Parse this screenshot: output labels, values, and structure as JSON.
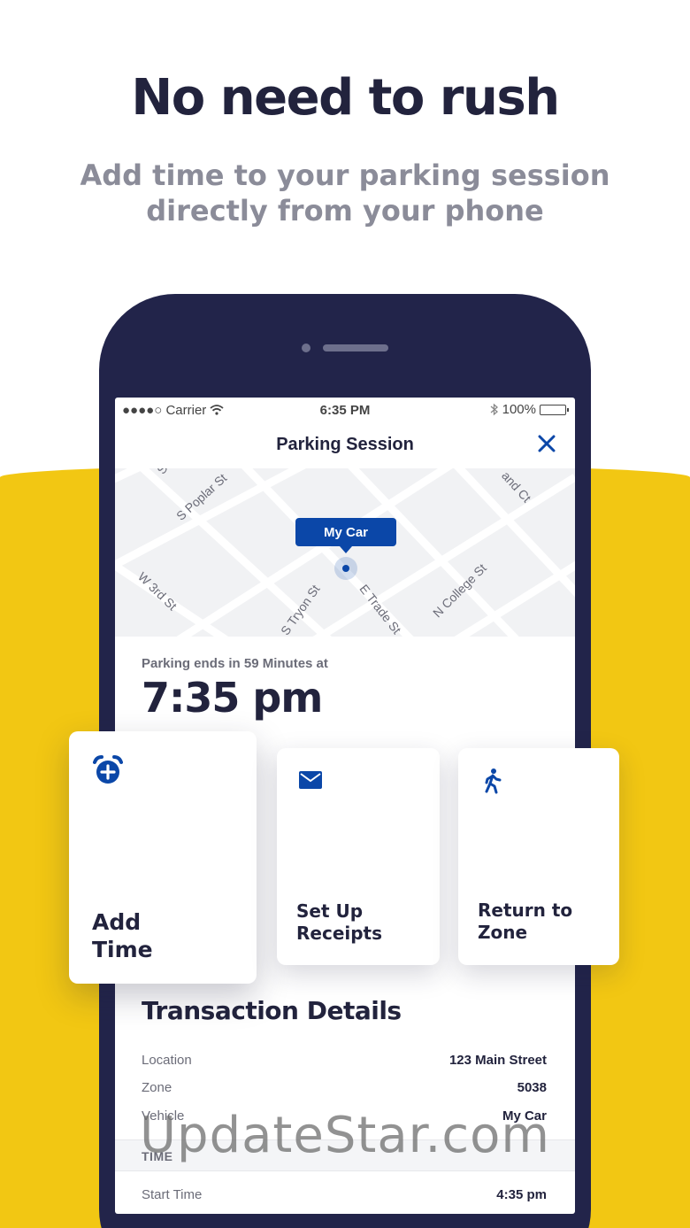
{
  "promo": {
    "headline": "No need to rush",
    "subheadline_line1": "Add time to your parking session",
    "subheadline_line2": "directly from your phone"
  },
  "status_bar": {
    "carrier": "●●●●○ Carrier",
    "time": "6:35 PM",
    "battery": "100%"
  },
  "nav": {
    "title": "Parking Session"
  },
  "map": {
    "pin_label": "My Car",
    "streets": [
      "S Poplar St",
      "W 3rd St",
      "S Tryon St",
      "E Trade St",
      "N College St",
      "S",
      "and Ct"
    ]
  },
  "session": {
    "ends_label": "Parking ends in 59 Minutes at",
    "ends_time": "7:35 pm"
  },
  "actions": {
    "add_time_line1": "Add",
    "add_time_line2": "Time",
    "receipts_line1": "Set Up",
    "receipts_line2": "Receipts",
    "return_line1": "Return to",
    "return_line2": "Zone"
  },
  "details": {
    "title": "Transaction Details",
    "rows": [
      {
        "key": "Location",
        "value": "123 Main Street"
      },
      {
        "key": "Zone",
        "value": "5038"
      },
      {
        "key": "Vehicle",
        "value": "My Car"
      }
    ],
    "time_header": "TIME",
    "time_rows": [
      {
        "key": "Start Time",
        "value": "4:35 pm"
      }
    ]
  },
  "watermark": "UpdateStar.com",
  "colors": {
    "brand_blue": "#0b47a8",
    "navy": "#22233d",
    "yellow": "#f2c713",
    "phone_body": "#22244a"
  }
}
